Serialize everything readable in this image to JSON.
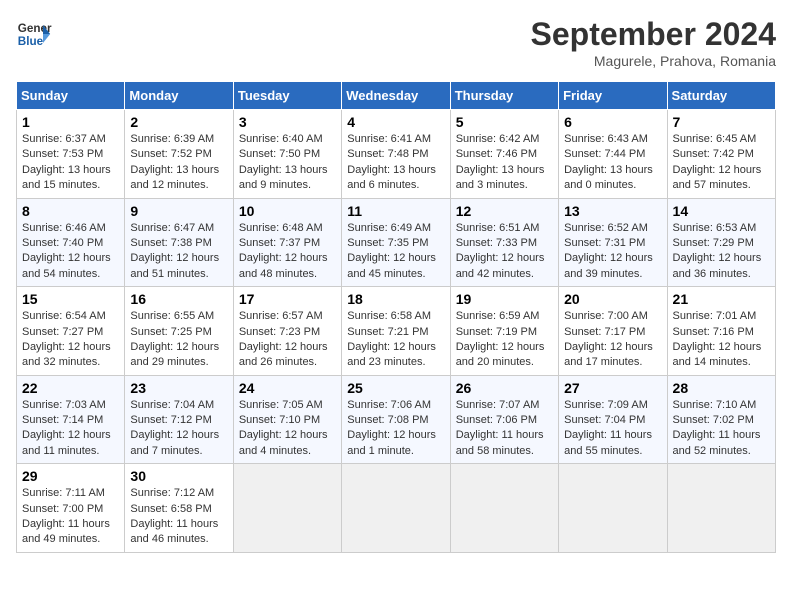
{
  "header": {
    "logo_line1": "General",
    "logo_line2": "Blue",
    "month_title": "September 2024",
    "subtitle": "Magurele, Prahova, Romania"
  },
  "weekdays": [
    "Sunday",
    "Monday",
    "Tuesday",
    "Wednesday",
    "Thursday",
    "Friday",
    "Saturday"
  ],
  "weeks": [
    [
      {
        "day": "1",
        "sunrise": "6:37 AM",
        "sunset": "7:53 PM",
        "daylight": "13 hours and 15 minutes."
      },
      {
        "day": "2",
        "sunrise": "6:39 AM",
        "sunset": "7:52 PM",
        "daylight": "13 hours and 12 minutes."
      },
      {
        "day": "3",
        "sunrise": "6:40 AM",
        "sunset": "7:50 PM",
        "daylight": "13 hours and 9 minutes."
      },
      {
        "day": "4",
        "sunrise": "6:41 AM",
        "sunset": "7:48 PM",
        "daylight": "13 hours and 6 minutes."
      },
      {
        "day": "5",
        "sunrise": "6:42 AM",
        "sunset": "7:46 PM",
        "daylight": "13 hours and 3 minutes."
      },
      {
        "day": "6",
        "sunrise": "6:43 AM",
        "sunset": "7:44 PM",
        "daylight": "13 hours and 0 minutes."
      },
      {
        "day": "7",
        "sunrise": "6:45 AM",
        "sunset": "7:42 PM",
        "daylight": "12 hours and 57 minutes."
      }
    ],
    [
      {
        "day": "8",
        "sunrise": "6:46 AM",
        "sunset": "7:40 PM",
        "daylight": "12 hours and 54 minutes."
      },
      {
        "day": "9",
        "sunrise": "6:47 AM",
        "sunset": "7:38 PM",
        "daylight": "12 hours and 51 minutes."
      },
      {
        "day": "10",
        "sunrise": "6:48 AM",
        "sunset": "7:37 PM",
        "daylight": "12 hours and 48 minutes."
      },
      {
        "day": "11",
        "sunrise": "6:49 AM",
        "sunset": "7:35 PM",
        "daylight": "12 hours and 45 minutes."
      },
      {
        "day": "12",
        "sunrise": "6:51 AM",
        "sunset": "7:33 PM",
        "daylight": "12 hours and 42 minutes."
      },
      {
        "day": "13",
        "sunrise": "6:52 AM",
        "sunset": "7:31 PM",
        "daylight": "12 hours and 39 minutes."
      },
      {
        "day": "14",
        "sunrise": "6:53 AM",
        "sunset": "7:29 PM",
        "daylight": "12 hours and 36 minutes."
      }
    ],
    [
      {
        "day": "15",
        "sunrise": "6:54 AM",
        "sunset": "7:27 PM",
        "daylight": "12 hours and 32 minutes."
      },
      {
        "day": "16",
        "sunrise": "6:55 AM",
        "sunset": "7:25 PM",
        "daylight": "12 hours and 29 minutes."
      },
      {
        "day": "17",
        "sunrise": "6:57 AM",
        "sunset": "7:23 PM",
        "daylight": "12 hours and 26 minutes."
      },
      {
        "day": "18",
        "sunrise": "6:58 AM",
        "sunset": "7:21 PM",
        "daylight": "12 hours and 23 minutes."
      },
      {
        "day": "19",
        "sunrise": "6:59 AM",
        "sunset": "7:19 PM",
        "daylight": "12 hours and 20 minutes."
      },
      {
        "day": "20",
        "sunrise": "7:00 AM",
        "sunset": "7:17 PM",
        "daylight": "12 hours and 17 minutes."
      },
      {
        "day": "21",
        "sunrise": "7:01 AM",
        "sunset": "7:16 PM",
        "daylight": "12 hours and 14 minutes."
      }
    ],
    [
      {
        "day": "22",
        "sunrise": "7:03 AM",
        "sunset": "7:14 PM",
        "daylight": "12 hours and 11 minutes."
      },
      {
        "day": "23",
        "sunrise": "7:04 AM",
        "sunset": "7:12 PM",
        "daylight": "12 hours and 7 minutes."
      },
      {
        "day": "24",
        "sunrise": "7:05 AM",
        "sunset": "7:10 PM",
        "daylight": "12 hours and 4 minutes."
      },
      {
        "day": "25",
        "sunrise": "7:06 AM",
        "sunset": "7:08 PM",
        "daylight": "12 hours and 1 minute."
      },
      {
        "day": "26",
        "sunrise": "7:07 AM",
        "sunset": "7:06 PM",
        "daylight": "11 hours and 58 minutes."
      },
      {
        "day": "27",
        "sunrise": "7:09 AM",
        "sunset": "7:04 PM",
        "daylight": "11 hours and 55 minutes."
      },
      {
        "day": "28",
        "sunrise": "7:10 AM",
        "sunset": "7:02 PM",
        "daylight": "11 hours and 52 minutes."
      }
    ],
    [
      {
        "day": "29",
        "sunrise": "7:11 AM",
        "sunset": "7:00 PM",
        "daylight": "11 hours and 49 minutes."
      },
      {
        "day": "30",
        "sunrise": "7:12 AM",
        "sunset": "6:58 PM",
        "daylight": "11 hours and 46 minutes."
      },
      null,
      null,
      null,
      null,
      null
    ]
  ]
}
